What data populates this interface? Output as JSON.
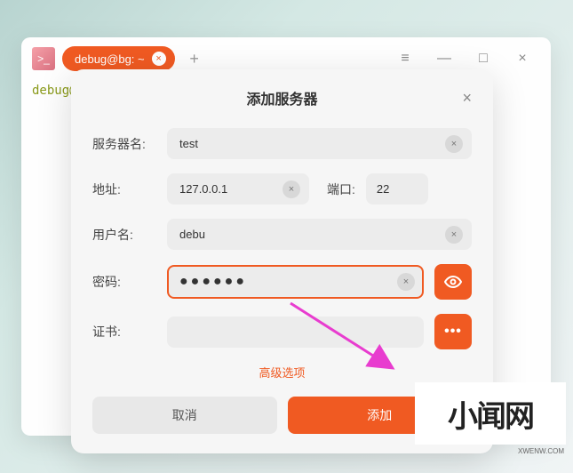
{
  "tab": {
    "label": "debug@bg: ~",
    "close": "×"
  },
  "newTab": "+",
  "winControls": {
    "menu": "≡",
    "min": "—",
    "max": "□",
    "close": "×"
  },
  "prompt": "debug@",
  "modal": {
    "title": "添加服务器",
    "close": "×",
    "serverName": {
      "label": "服务器名:",
      "value": "test"
    },
    "address": {
      "label": "地址:",
      "value": "127.0.0.1"
    },
    "port": {
      "label": "端口:",
      "value": "22"
    },
    "username": {
      "label": "用户名:",
      "value": "debu"
    },
    "password": {
      "label": "密码:",
      "value": "●●●●●●"
    },
    "cert": {
      "label": "证书:",
      "value": ""
    },
    "advanced": "高级选项",
    "cancel": "取消",
    "submit": "添加"
  },
  "watermark": {
    "main": "小闻网",
    "sub": "XWENW.COM"
  }
}
